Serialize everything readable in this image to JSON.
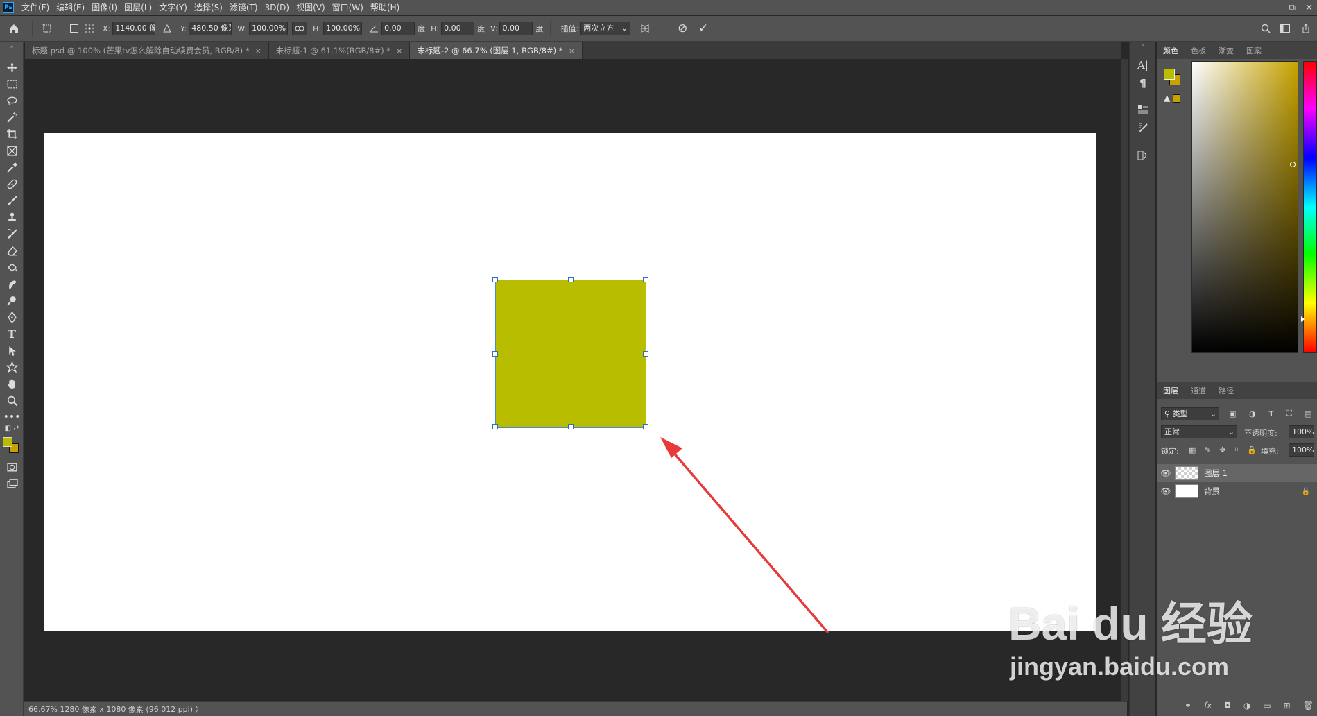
{
  "app": {
    "logo": "Ps"
  },
  "menu": [
    "文件(F)",
    "编辑(E)",
    "图像(I)",
    "图层(L)",
    "文字(Y)",
    "选择(S)",
    "滤镜(T)",
    "3D(D)",
    "视图(V)",
    "窗口(W)",
    "帮助(H)"
  ],
  "window_controls": {
    "minimize": "—",
    "restore": "⧉",
    "close": "✕"
  },
  "options": {
    "x_label": "X:",
    "x_value": "1140.00 像",
    "y_label": "Y:",
    "y_value": "480.50 像茅",
    "w_label": "W:",
    "w_value": "100.00%",
    "h_label": "H:",
    "h_value": "100.00%",
    "rot_value": "0.00",
    "rot_unit": "度",
    "hskew_label": "H:",
    "hskew_value": "0.00",
    "hskew_unit": "度",
    "vskew_label": "V:",
    "vskew_value": "0.00",
    "vskew_unit": "度",
    "interp_label": "插值:",
    "interp_value": "两次立方",
    "cancel_glyph": "⊘",
    "commit_glyph": "✓"
  },
  "tabs": [
    {
      "label": "标题.psd @ 100% (芒果tv怎么解除自动续费会员, RGB/8) *",
      "active": false
    },
    {
      "label": "未标题-1 @ 61.1%(RGB/8#) *",
      "active": false
    },
    {
      "label": "未标题-2 @ 66.7% (图层 1, RGB/8#) *",
      "active": true
    }
  ],
  "tab_close": "×",
  "colors": {
    "foreground": "#b8bd00",
    "background": "#c8a300",
    "shape": "#b8bd00"
  },
  "color_panel": {
    "tabs": [
      "颜色",
      "色板",
      "渐变",
      "图案"
    ]
  },
  "layers_panel": {
    "tabs": [
      "图层",
      "通道",
      "路径"
    ],
    "filter_label": "类型",
    "blend_mode": "正常",
    "opacity_label": "不透明度:",
    "opacity_value": "100%",
    "lock_label": "锁定:",
    "fill_label": "填充:",
    "fill_value": "100%",
    "layers": [
      {
        "name": "图层 1",
        "selected": true,
        "lock": ""
      },
      {
        "name": "背景",
        "selected": false,
        "lock": "🔒"
      }
    ],
    "bottom_icons": [
      "⚭",
      "fx",
      "◘",
      "◑",
      "▭",
      "⊞",
      "🗑"
    ]
  },
  "status": {
    "text": "66.67%  1280 像素 x 1080 像素 (96.012 ppi)  〉"
  },
  "watermark": {
    "brand": "Bai  du 经验",
    "url": "jingyan.baidu.com"
  }
}
